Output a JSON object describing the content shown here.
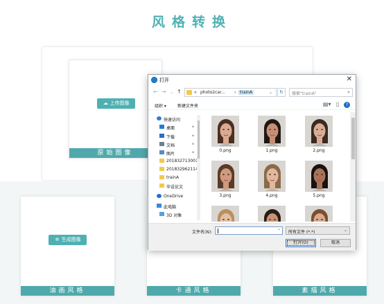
{
  "page": {
    "title": "风格转换"
  },
  "upload_card": {
    "button_label": "上传图像",
    "label": "原始图像"
  },
  "generate_card": {
    "button_label": "生成图像",
    "label": "油画风格"
  },
  "result_cards": [
    {
      "label": "卡通风格"
    },
    {
      "label": "素描风格"
    }
  ],
  "dialog": {
    "title": "打开",
    "address": {
      "crumb_prefix": "«",
      "crumb_parent": "photo2car...",
      "separator": "›",
      "crumb_current": "trainA"
    },
    "search_placeholder": "搜索\"trainA\"",
    "toolbar": {
      "organize": "组织 ▾",
      "new_folder": "新建文件夹"
    },
    "sidebar": [
      {
        "label": "快速访问",
        "icon": "star-icon",
        "pinned": false
      },
      {
        "label": "桌面",
        "icon": "desktop-icon",
        "pinned": true
      },
      {
        "label": "下载",
        "icon": "download-icon",
        "pinned": true
      },
      {
        "label": "文档",
        "icon": "document-icon",
        "pinned": true
      },
      {
        "label": "图片",
        "icon": "picture-icon",
        "pinned": true
      },
      {
        "label": "201832713001",
        "icon": "folder-icon",
        "pinned": false
      },
      {
        "label": "2018329621146",
        "icon": "folder-icon",
        "pinned": false
      },
      {
        "label": "trainA",
        "icon": "folder-icon",
        "pinned": false
      },
      {
        "label": "毕设论文",
        "icon": "folder-icon",
        "pinned": false
      },
      {
        "label": "OneDrive",
        "icon": "cloud-icon",
        "pinned": false
      },
      {
        "label": "此电脑",
        "icon": "computer-icon",
        "pinned": false
      },
      {
        "label": "3D 对象",
        "icon": "cube-icon",
        "pinned": false
      }
    ],
    "files": [
      {
        "name": "0.png",
        "skin": "#d8ab92",
        "hair": "#4a2e20"
      },
      {
        "name": "1.png",
        "skin": "#c48f74",
        "hair": "#1f1713"
      },
      {
        "name": "2.png",
        "skin": "#d9ad95",
        "hair": "#3a2a22"
      },
      {
        "name": "3.png",
        "skin": "#cf9a7d",
        "hair": "#5a3a28"
      },
      {
        "name": "4.png",
        "skin": "#e1b79e",
        "hair": "#8a6a48"
      },
      {
        "name": "5.png",
        "skin": "#a87458",
        "hair": "#1a1210"
      },
      {
        "name": "6.png",
        "skin": "#e3bfa6",
        "hair": "#b89060"
      },
      {
        "name": "7.png",
        "skin": "#c99478",
        "hair": "#2a1c16"
      },
      {
        "name": "8.png",
        "skin": "#d9aa8c",
        "hair": "#7a5030"
      }
    ],
    "filename_label": "文件名(N):",
    "filename_value": "",
    "filetype_value": "所有文件 (*.*)",
    "open_label": "打开(O)",
    "cancel_label": "取消",
    "colors": {
      "accent": "#4fb0b2",
      "focus": "#3c7fd4"
    }
  }
}
